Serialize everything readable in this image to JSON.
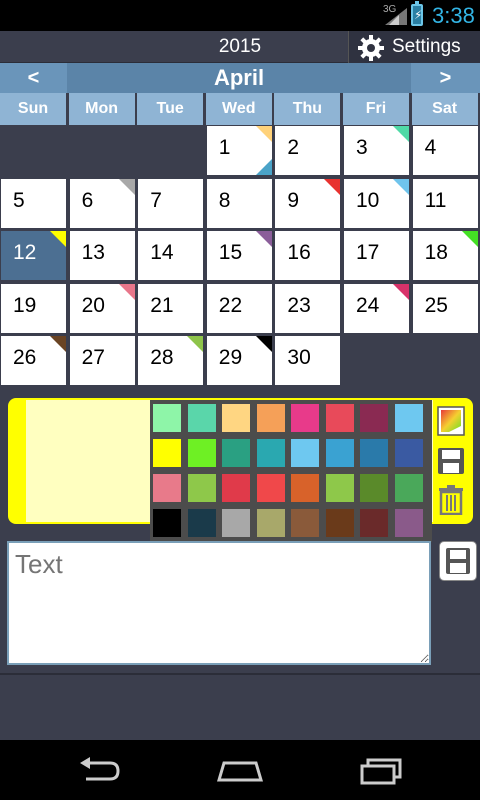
{
  "status": {
    "network": "3G",
    "time": "3:38"
  },
  "header": {
    "year": "2015",
    "settings_label": "Settings"
  },
  "month": {
    "prev": "<",
    "title": "April",
    "next": ">"
  },
  "weekdays": [
    "Sun",
    "Mon",
    "Tue",
    "Wed",
    "Thu",
    "Fri",
    "Sat"
  ],
  "days": [
    {
      "n": "1",
      "col": 3,
      "row": 0,
      "flag": "#ffd27a",
      "flag2": "#4aa3c8"
    },
    {
      "n": "2",
      "col": 4,
      "row": 0
    },
    {
      "n": "3",
      "col": 5,
      "row": 0,
      "flag": "#4fd9a6"
    },
    {
      "n": "4",
      "col": 6,
      "row": 0
    },
    {
      "n": "5",
      "col": 0,
      "row": 1
    },
    {
      "n": "6",
      "col": 1,
      "row": 1,
      "flag": "#a8a8a8"
    },
    {
      "n": "7",
      "col": 2,
      "row": 1
    },
    {
      "n": "8",
      "col": 3,
      "row": 1
    },
    {
      "n": "9",
      "col": 4,
      "row": 1,
      "flag": "#e8322f"
    },
    {
      "n": "10",
      "col": 5,
      "row": 1,
      "flag": "#6fc4ec"
    },
    {
      "n": "11",
      "col": 6,
      "row": 1
    },
    {
      "n": "12",
      "col": 0,
      "row": 2,
      "flag": "#ffff00",
      "selected": true
    },
    {
      "n": "13",
      "col": 1,
      "row": 2
    },
    {
      "n": "14",
      "col": 2,
      "row": 2
    },
    {
      "n": "15",
      "col": 3,
      "row": 2,
      "flag": "#8b5e9a"
    },
    {
      "n": "16",
      "col": 4,
      "row": 2
    },
    {
      "n": "17",
      "col": 5,
      "row": 2
    },
    {
      "n": "18",
      "col": 6,
      "row": 2,
      "flag": "#44e024"
    },
    {
      "n": "19",
      "col": 0,
      "row": 3
    },
    {
      "n": "20",
      "col": 1,
      "row": 3,
      "flag": "#e8768a"
    },
    {
      "n": "21",
      "col": 2,
      "row": 3
    },
    {
      "n": "22",
      "col": 3,
      "row": 3
    },
    {
      "n": "23",
      "col": 4,
      "row": 3
    },
    {
      "n": "24",
      "col": 5,
      "row": 3,
      "flag": "#d8326a"
    },
    {
      "n": "25",
      "col": 6,
      "row": 3
    },
    {
      "n": "26",
      "col": 0,
      "row": 4,
      "flag": "#6a4424"
    },
    {
      "n": "27",
      "col": 1,
      "row": 4
    },
    {
      "n": "28",
      "col": 2,
      "row": 4,
      "flag": "#8ec44a"
    },
    {
      "n": "29",
      "col": 3,
      "row": 4,
      "flag": "#000000"
    },
    {
      "n": "30",
      "col": 4,
      "row": 4
    }
  ],
  "palette": [
    "#8ef5a8",
    "#5ad6aa",
    "#ffd682",
    "#f5a058",
    "#e83a8a",
    "#e84a5a",
    "#8a2a52",
    "#6ec8f0",
    "#ffff00",
    "#6ef024",
    "#2aa082",
    "#2aa8b0",
    "#6ec8f0",
    "#3aa2d2",
    "#2a7aaa",
    "#3a5aa2",
    "#e87a8a",
    "#8ec84a",
    "#e03a4a",
    "#f0484a",
    "#d8622a",
    "#8ec84a",
    "#5a8a2a",
    "#4aa85a",
    "#000000",
    "#1a3a4a",
    "#a8a8a8",
    "#a8a86a",
    "#8a5a3a",
    "#6a3a1a",
    "#6a2a2a",
    "#8a5a8a"
  ],
  "note": {
    "color": "#ffff00"
  },
  "input": {
    "placeholder": "Text"
  }
}
